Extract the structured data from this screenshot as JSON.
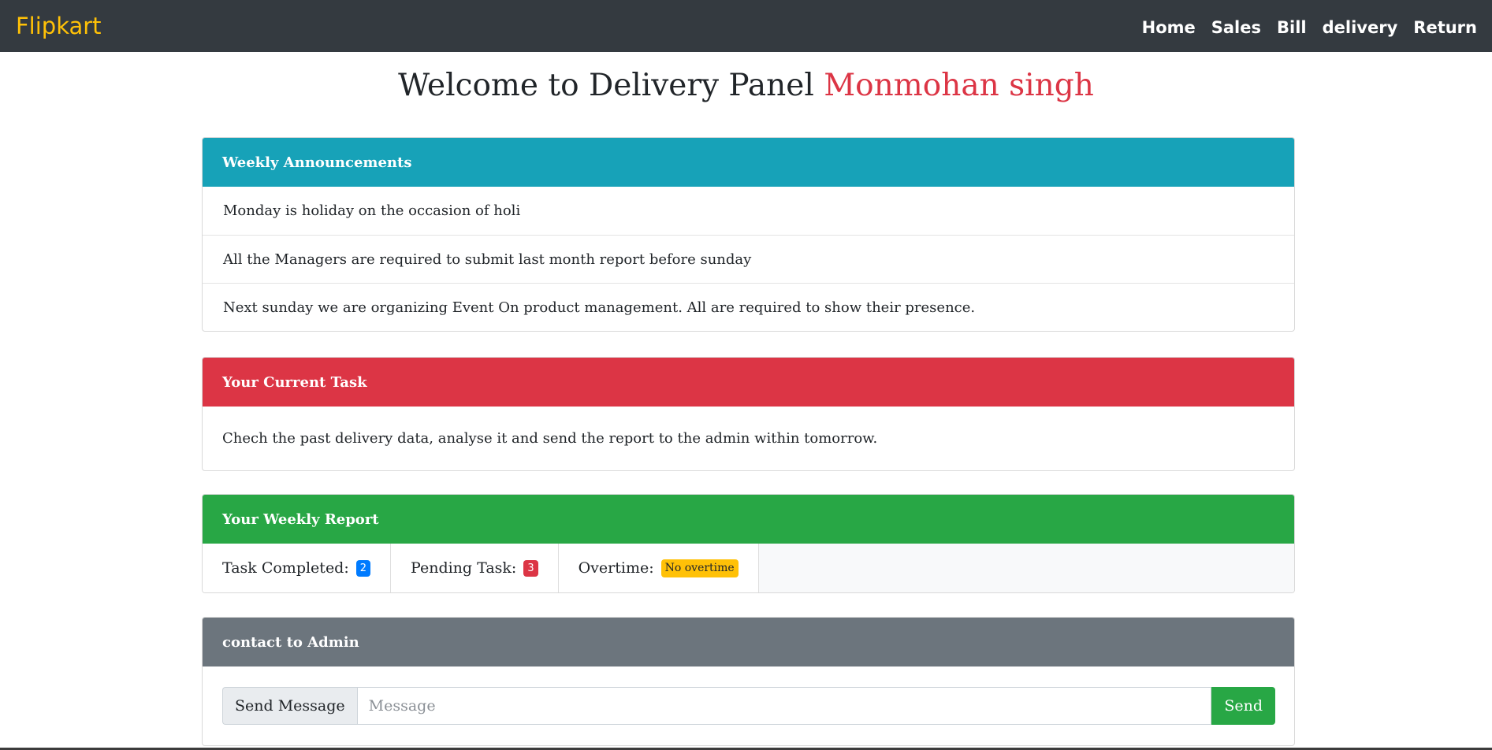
{
  "navbar": {
    "brand": "Flipkart",
    "links": [
      "Home",
      "Sales",
      "Bill",
      "delivery",
      "Return"
    ]
  },
  "welcome": {
    "prefix": "Welcome to Delivery Panel",
    "name": "Monmohan singh"
  },
  "announcements": {
    "header": "Weekly Announcements",
    "items": [
      "Monday is holiday on the occasion of holi",
      "All the Managers are required to submit last month report before sunday",
      "Next sunday we are organizing Event On product management. All are required to show their presence."
    ]
  },
  "current_task": {
    "header": "Your Current Task",
    "text": "Chech the past delivery data, analyse it and send the report to the admin within tomorrow."
  },
  "weekly_report": {
    "header": "Your Weekly Report",
    "completed_label": "Task Completed:",
    "completed_value": "2",
    "pending_label": "Pending Task:",
    "pending_value": "3",
    "overtime_label": "Overtime:",
    "overtime_value": "No overtime"
  },
  "contact": {
    "header": "contact to Admin",
    "prepend_label": "Send Message",
    "placeholder": "Message",
    "send_label": "Send"
  },
  "colors": {
    "brand": "#ffc107",
    "navbar": "#343a40",
    "info": "#17a2b8",
    "danger": "#dc3545",
    "success": "#28a745",
    "secondary": "#6c757d"
  }
}
